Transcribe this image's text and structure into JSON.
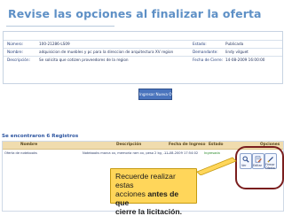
{
  "title": "Revise las opciones al finalizar la oferta",
  "info": {
    "numero_label": "Número:",
    "numero_value": "100-21286-LS09",
    "nombre_label": "Nombre:",
    "nombre_value": "adquisicion de muebles y pc para la direccion de arquitectura XV region",
    "descripcion_label": "Descripción:",
    "descripcion_value": "Se solicita que cotizen proveedores de la region",
    "estado_label": "Estado:",
    "estado_value": "Publicada",
    "demandante_label": "Demandante:",
    "demandante_value": "lindy vilguet",
    "cierre_label": "Fecha de Cierre:",
    "cierre_value": "14-08-2009 16:00:00"
  },
  "buttons": {
    "ingresar": "Ingresar Nueva Oferta"
  },
  "results": {
    "found_text": "Se encontraron 6 Registros"
  },
  "table": {
    "headers": [
      "Nombre",
      "Descripción",
      "Fecha de Ingreso",
      "Estado",
      "Opciones"
    ],
    "row": {
      "nombre": "Oferta de notebooks",
      "descripcion": "Notebooks marca xx, memoria ram xx, peso 2 kg, ......",
      "fecha": "11-08-2009 17:54:02",
      "estado": "Ingresada"
    }
  },
  "options": {
    "ver_label": "Ver",
    "editar_label": "Editar",
    "firmar_label": "Firmar",
    "oferta_label": "Oferta"
  },
  "callout": {
    "line1": "Recuerde realizar estas",
    "line2_prefix": "acciones ",
    "line2_bold": "antes de que",
    "line3_bold": "cierre la licitación."
  },
  "colors": {
    "title": "#5e90c6",
    "callout_bg": "#ffd65a",
    "header_bg": "#f0dcae",
    "button_bg": "#4a74bd",
    "highlight": "#7a1e1e"
  }
}
